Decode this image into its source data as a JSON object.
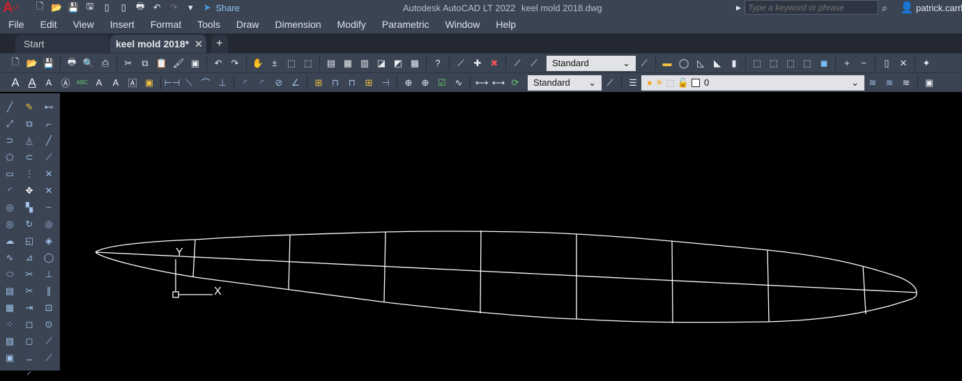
{
  "titlebar": {
    "app_title": "Autodesk AutoCAD LT 2022",
    "file_title": "keel mold 2018.dwg",
    "share_label": "Share",
    "search_placeholder": "Type a keyword or phrase",
    "username": "patrick.carrl",
    "app_letter": "A",
    "app_badge": "LT"
  },
  "menu": [
    "File",
    "Edit",
    "View",
    "Insert",
    "Format",
    "Tools",
    "Draw",
    "Dimension",
    "Modify",
    "Parametric",
    "Window",
    "Help"
  ],
  "tabs": {
    "start": "Start",
    "active": "keel mold 2018*",
    "close": "✕",
    "new": "+"
  },
  "toolbar": {
    "style_combo": "Standard",
    "dimstyle_combo": "Standard",
    "layer_combo": "0"
  },
  "ucs": {
    "x_label": "X",
    "y_label": "Y"
  },
  "colors": {
    "accent": "#2f8fdc",
    "panel": "#3b4453",
    "tabbar": "#232833"
  }
}
